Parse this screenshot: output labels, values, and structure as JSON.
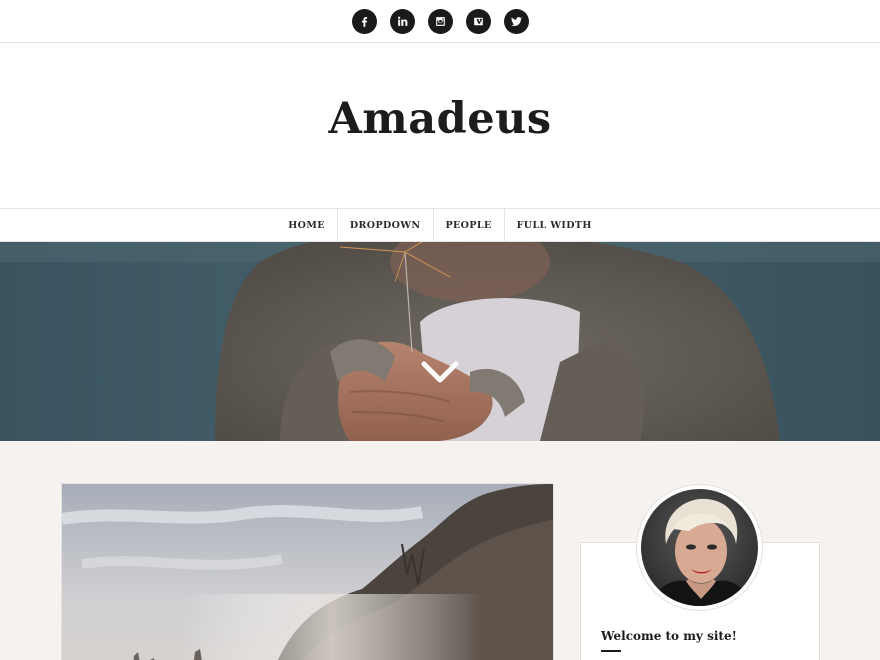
{
  "social": {
    "items": [
      {
        "name": "facebook-icon",
        "glyph": "f"
      },
      {
        "name": "linkedin-icon",
        "glyph": "in"
      },
      {
        "name": "instagram-icon",
        "glyph": "ig"
      },
      {
        "name": "vimeo-icon",
        "glyph": "v"
      },
      {
        "name": "twitter-icon",
        "glyph": "tw"
      }
    ]
  },
  "site": {
    "title": "Amadeus"
  },
  "nav": {
    "items": [
      {
        "label": "HOME"
      },
      {
        "label": "DROPDOWN"
      },
      {
        "label": "PEOPLE"
      },
      {
        "label": "FULL WIDTH"
      }
    ]
  },
  "hero": {
    "scroll_icon": "chevron-down-icon"
  },
  "sidebar": {
    "widget_title": "Welcome to my site!"
  },
  "colors": {
    "text": "#1c1c1c",
    "content_bg": "#f5f2ef",
    "border": "#e3e3e3",
    "social_bg": "#1a1a1a"
  }
}
